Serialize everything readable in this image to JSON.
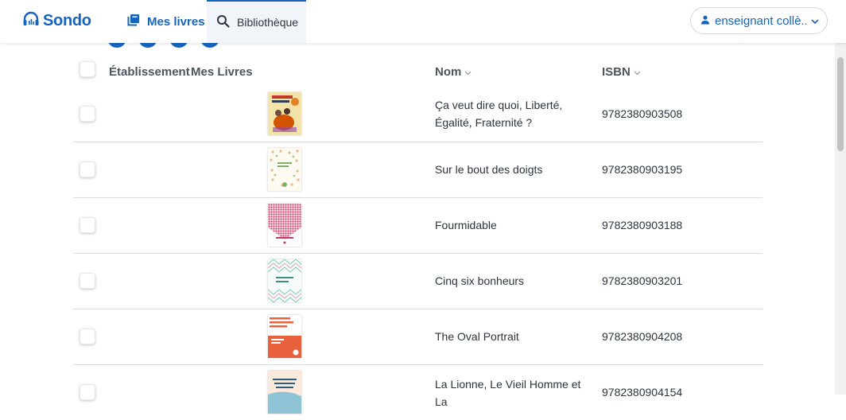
{
  "header": {
    "logo_text": "Sondo",
    "tabs": [
      {
        "label": "Mes livres",
        "icon": "book-icon",
        "active": false
      },
      {
        "label": "Bibliothèque",
        "icon": "search-icon",
        "active": true
      }
    ],
    "user_label": "enseignant collè...",
    "brand_color": "#1565c0"
  },
  "table": {
    "headers": {
      "etablissement": "Établissement",
      "mes_livres": "Mes Livres",
      "nom": "Nom",
      "isbn": "ISBN"
    },
    "rows": [
      {
        "title": "Ça veut dire quoi, Liberté, Égalité, Fraternité ?",
        "isbn": "9782380903508"
      },
      {
        "title": "Sur le bout des doigts",
        "isbn": "9782380903195"
      },
      {
        "title": "Fourmidable",
        "isbn": "9782380903188"
      },
      {
        "title": "Cinq six bonheurs",
        "isbn": "9782380903201"
      },
      {
        "title": "The Oval Portrait",
        "isbn": "9782380904208"
      },
      {
        "title": "La Lionne, Le Vieil Homme et La",
        "isbn": "9782380904154"
      }
    ]
  }
}
